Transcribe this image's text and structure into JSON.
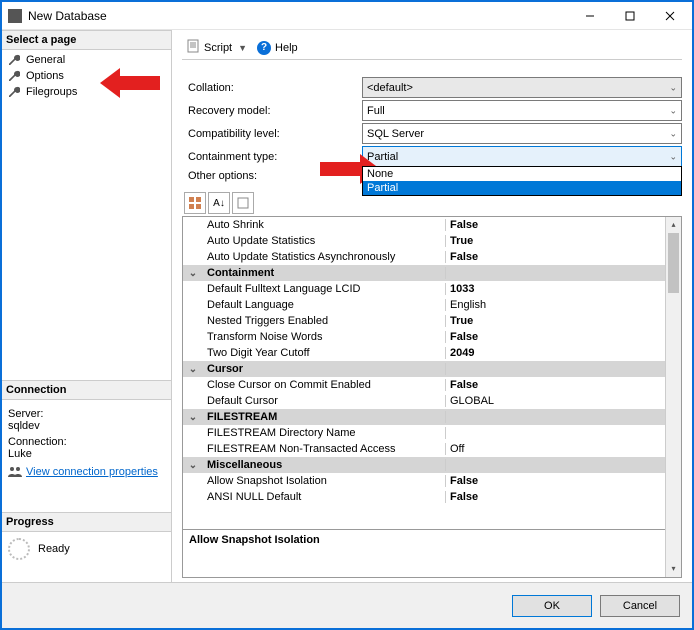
{
  "window": {
    "title": "New Database"
  },
  "sidebar": {
    "select_page": "Select a page",
    "pages": [
      "General",
      "Options",
      "Filegroups"
    ],
    "connection_head": "Connection",
    "server_label": "Server:",
    "server_value": "sqldev",
    "conn_label": "Connection:",
    "conn_value": "Luke",
    "view_conn": "View connection properties",
    "progress_head": "Progress",
    "progress_status": "Ready"
  },
  "toolbar": {
    "script": "Script",
    "help": "Help"
  },
  "form": {
    "collation_label": "Collation:",
    "collation_value": "<default>",
    "recovery_label": "Recovery model:",
    "recovery_value": "Full",
    "compat_label": "Compatibility level:",
    "compat_value": "SQL Server",
    "containment_label": "Containment type:",
    "containment_value": "Partial",
    "containment_options": [
      "None",
      "Partial"
    ],
    "other_label": "Other options:"
  },
  "grid": {
    "rows": [
      {
        "cat": false,
        "name": "Auto Shrink",
        "val": "False"
      },
      {
        "cat": false,
        "name": "Auto Update Statistics",
        "val": "True"
      },
      {
        "cat": false,
        "name": "Auto Update Statistics Asynchronously",
        "val": "False"
      },
      {
        "cat": true,
        "name": "Containment",
        "val": ""
      },
      {
        "cat": false,
        "name": "Default Fulltext Language LCID",
        "val": "1033"
      },
      {
        "cat": false,
        "name": "Default Language",
        "val": "English"
      },
      {
        "cat": false,
        "name": "Nested Triggers Enabled",
        "val": "True"
      },
      {
        "cat": false,
        "name": "Transform Noise Words",
        "val": "False"
      },
      {
        "cat": false,
        "name": "Two Digit Year Cutoff",
        "val": "2049"
      },
      {
        "cat": true,
        "name": "Cursor",
        "val": ""
      },
      {
        "cat": false,
        "name": "Close Cursor on Commit Enabled",
        "val": "False"
      },
      {
        "cat": false,
        "name": "Default Cursor",
        "val": "GLOBAL"
      },
      {
        "cat": true,
        "name": "FILESTREAM",
        "val": ""
      },
      {
        "cat": false,
        "name": "FILESTREAM Directory Name",
        "val": ""
      },
      {
        "cat": false,
        "name": "FILESTREAM Non-Transacted Access",
        "val": "Off"
      },
      {
        "cat": true,
        "name": "Miscellaneous",
        "val": ""
      },
      {
        "cat": false,
        "name": "Allow Snapshot Isolation",
        "val": "False"
      },
      {
        "cat": false,
        "name": "ANSI NULL Default",
        "val": "False"
      }
    ],
    "desc_name": "Allow Snapshot Isolation"
  },
  "footer": {
    "ok": "OK",
    "cancel": "Cancel"
  }
}
